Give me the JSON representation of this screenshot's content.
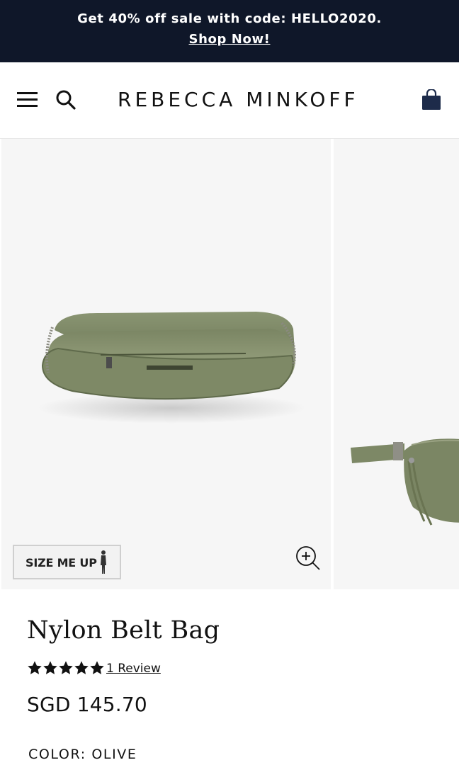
{
  "promo": {
    "text": "Get 40% off sale with code: HELLO2020.",
    "link": "Shop Now!"
  },
  "header": {
    "brand": "REBECCA MINKOFF",
    "menu_icon": "hamburger-menu-icon",
    "search_icon": "search-icon",
    "cart_icon": "shopping-bag-icon"
  },
  "gallery": {
    "size_me_up_label": "SIZE ME UP",
    "zoom_icon": "zoom-in-icon"
  },
  "product": {
    "title": "Nylon Belt Bag",
    "rating": 5,
    "rating_max": 5,
    "reviews_label": "1 Review",
    "price": "SGD 145.70",
    "color_label": "COLOR:",
    "color_value": "OLIVE"
  },
  "colors": {
    "promo_bg": "#0f1729",
    "bag_olive": "#7d8866",
    "star": "#111111"
  }
}
